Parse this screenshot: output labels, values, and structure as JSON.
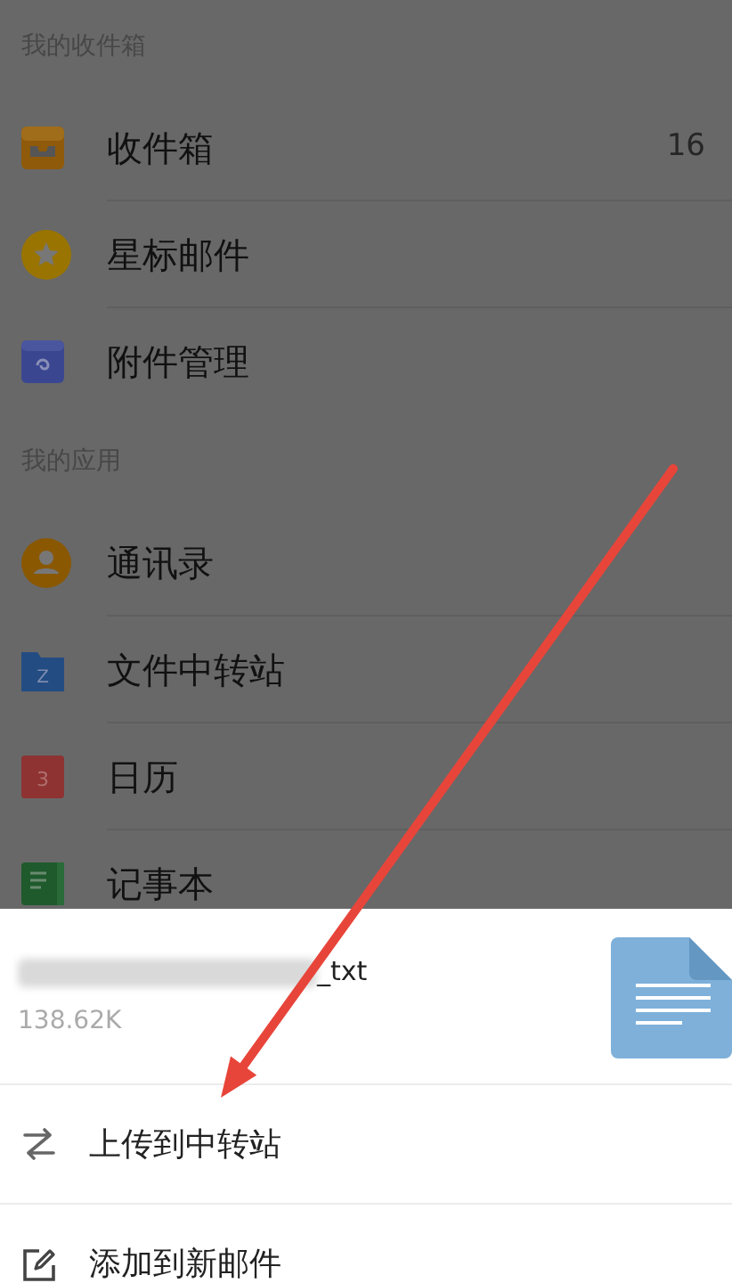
{
  "sections": [
    {
      "title": "我的收件箱",
      "items": [
        {
          "kind": "inbox",
          "label": "收件箱",
          "count": "16"
        },
        {
          "kind": "star",
          "label": "星标邮件"
        },
        {
          "kind": "attachment",
          "label": "附件管理"
        }
      ]
    },
    {
      "title": "我的应用",
      "items": [
        {
          "kind": "contacts",
          "label": "通讯录"
        },
        {
          "kind": "folder",
          "label": "文件中转站",
          "icon_text": "Z"
        },
        {
          "kind": "calendar",
          "label": "日历",
          "icon_text": "3"
        },
        {
          "kind": "notes",
          "label": "记事本"
        }
      ]
    }
  ],
  "sheet": {
    "file": {
      "name": "_txt",
      "size": "138.62K"
    },
    "actions": [
      {
        "kind": "upload",
        "label": "上传到中转站"
      },
      {
        "kind": "compose",
        "label": "添加到新邮件"
      }
    ]
  }
}
